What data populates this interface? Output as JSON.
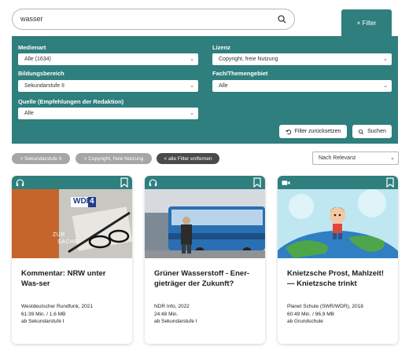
{
  "search": {
    "value": "wasser"
  },
  "filter_tab": {
    "label": "× Filter"
  },
  "filters": {
    "medienart": {
      "label": "Medienart",
      "value": "Alle (1634)"
    },
    "lizenz": {
      "label": "Lizenz",
      "value": "Copyright, freie Nutzung"
    },
    "bildungsbereich": {
      "label": "Bildungsbereich",
      "value": "Sekundarstufe II"
    },
    "fach": {
      "label": "Fach/Themengebiet",
      "value": "Alle"
    },
    "quelle": {
      "label": "Quelle (Empfehlungen der Redaktion)",
      "value": "Alle"
    },
    "reset_label": "Filter zurücksetzen",
    "search_label": "Suchen"
  },
  "active_filters": {
    "chip1": "× Sekundarstufe II",
    "chip2": "× Copyright, freie Nutzung",
    "remove_all": "< alle Filter entfernen"
  },
  "sort": {
    "value": "Nach Relevanz"
  },
  "results": [
    {
      "type_icon": "headphones-icon",
      "thumb_text": [
        "WDR",
        "4",
        "ZUR",
        "SACHE"
      ],
      "title": "Kommentar: NRW unter Was-ser",
      "source": "Westdeutscher Rundfunk, 2021",
      "duration": "61:39 Min. / 1,6 MB",
      "level": "ab Sekundarstufe I"
    },
    {
      "type_icon": "headphones-icon",
      "title": "Grüner Wasserstoff - Ener-gieträger der Zukunft?",
      "source": "NDR Info, 2022",
      "duration": "24:48 Min.",
      "level": "ab Sekundarstufe I"
    },
    {
      "type_icon": "video-icon",
      "title": "Knietzsche Prost, Mahlzeit! — Knietzsche trinkt",
      "source": "Planet Schule (SWR/WDR), 2018",
      "duration": "60:49 Min. / 96,9 MB",
      "level": "ab Grundschule"
    }
  ],
  "colors": {
    "teal": "#2e7f7e",
    "chip_grey": "#a6a6a6",
    "chip_dark": "#4a4a4a"
  }
}
